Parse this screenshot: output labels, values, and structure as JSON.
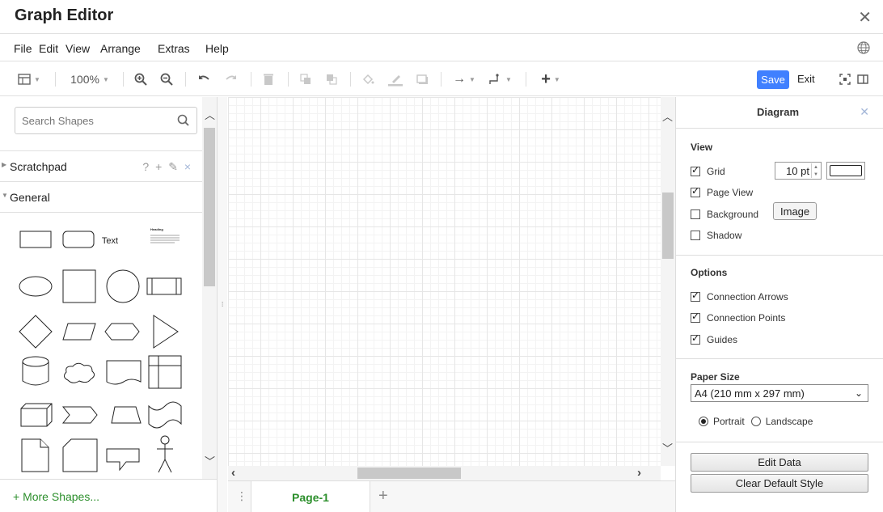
{
  "app": {
    "title": "Graph Editor"
  },
  "menubar": {
    "items": [
      "File",
      "Edit",
      "View",
      "Arrange",
      "Extras",
      "Help"
    ]
  },
  "toolbar": {
    "zoom": "100%",
    "save_label": "Save",
    "exit_label": "Exit"
  },
  "left_panel": {
    "search": {
      "placeholder": "Search Shapes"
    },
    "scratchpad": {
      "label": "Scratchpad",
      "tools": [
        "?",
        "+",
        "✎",
        "×"
      ]
    },
    "general": {
      "label": "General"
    },
    "shape_text_label": "Text",
    "shape_heading_label": "Heading",
    "more_shapes": "+ More Shapes..."
  },
  "pages": {
    "tabs": [
      "Page-1"
    ]
  },
  "right_panel": {
    "title": "Diagram",
    "view": {
      "heading": "View",
      "grid": {
        "label": "Grid",
        "checked": true,
        "size": "10 pt"
      },
      "page_view": {
        "label": "Page View",
        "checked": true
      },
      "background": {
        "label": "Background",
        "checked": false,
        "button": "Image"
      },
      "shadow": {
        "label": "Shadow",
        "checked": false
      }
    },
    "options": {
      "heading": "Options",
      "connection_arrows": {
        "label": "Connection Arrows",
        "checked": true
      },
      "connection_points": {
        "label": "Connection Points",
        "checked": true
      },
      "guides": {
        "label": "Guides",
        "checked": true
      }
    },
    "paper": {
      "heading": "Paper Size",
      "size": "A4 (210 mm x 297 mm)",
      "portrait": "Portrait",
      "landscape": "Landscape",
      "orientation": "Portrait"
    },
    "buttons": {
      "edit_data": "Edit Data",
      "clear_style": "Clear Default Style"
    }
  },
  "colors": {
    "accent": "#4080ff",
    "green_link": "#2c8f2c",
    "grid_line": "#e6e6e6"
  }
}
